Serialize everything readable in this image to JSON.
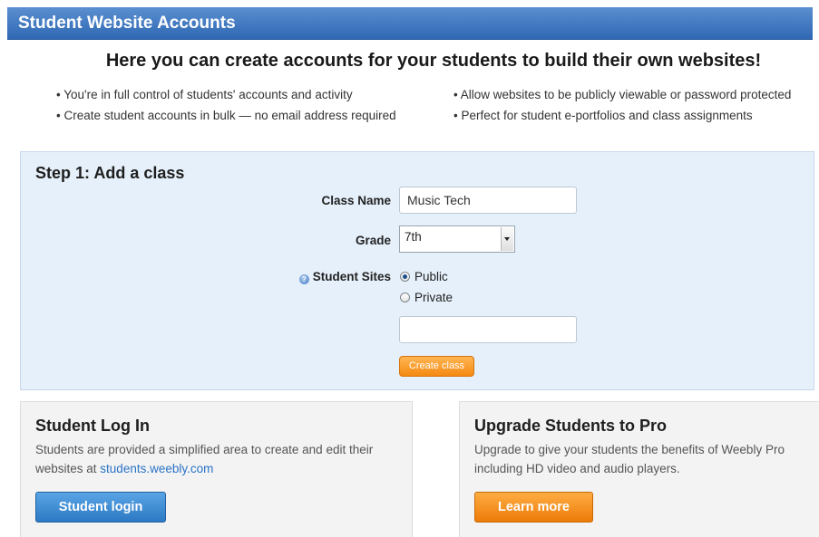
{
  "header": {
    "title": "Student Website Accounts"
  },
  "intro": {
    "headline": "Here you can create accounts for your students to build their own websites!",
    "bullets_left": [
      "• You're in full control of students' accounts and activity",
      "• Create student accounts in bulk — no email address required"
    ],
    "bullets_right": [
      "• Allow websites to be publicly viewable or password protected",
      "• Perfect for student e-portfolios and class assignments"
    ]
  },
  "step1": {
    "title": "Step 1: Add a class",
    "class_name_label": "Class Name",
    "class_name_value": "Music Tech",
    "grade_label": "Grade",
    "grade_value": "7th",
    "student_sites_label": "Student Sites",
    "radio_public": "Public",
    "radio_private": "Private",
    "password_value": "",
    "create_button": "Create class"
  },
  "login_card": {
    "title": "Student Log In",
    "text_before_link": "Students are provided a simplified area to create and edit their websites at ",
    "link_text": "students.weebly.com",
    "button": "Student login"
  },
  "pro_card": {
    "title": "Upgrade Students to Pro",
    "text": "Upgrade to give your students the benefits of Weebly Pro including HD video and audio players.",
    "button": "Learn more"
  },
  "colors": {
    "header_blue": "#2f68b3",
    "panel_blue": "#e6f0fa",
    "orange": "#f48a12",
    "link_blue": "#2a73c7"
  }
}
